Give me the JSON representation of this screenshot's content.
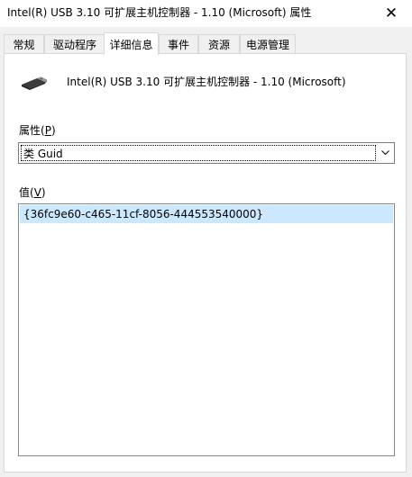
{
  "window": {
    "title": "Intel(R) USB 3.10 可扩展主机控制器 - 1.10 (Microsoft) 属性",
    "close_glyph": "✕"
  },
  "tabs": [
    {
      "label": "常规",
      "active": false
    },
    {
      "label": "驱动程序",
      "active": false
    },
    {
      "label": "详细信息",
      "active": true
    },
    {
      "label": "事件",
      "active": false
    },
    {
      "label": "资源",
      "active": false
    },
    {
      "label": "电源管理",
      "active": false
    }
  ],
  "device": {
    "name": "Intel(R) USB 3.10 可扩展主机控制器 - 1.10 (Microsoft)",
    "icon": "usb-device-icon"
  },
  "property": {
    "label_text": "属性(",
    "label_key": "P",
    "label_end": ")",
    "selected": "类 Guid"
  },
  "value": {
    "label_text": "值(",
    "label_key": "V",
    "label_end": ")",
    "items": [
      "{36fc9e60-c465-11cf-8056-444553540000}"
    ]
  }
}
